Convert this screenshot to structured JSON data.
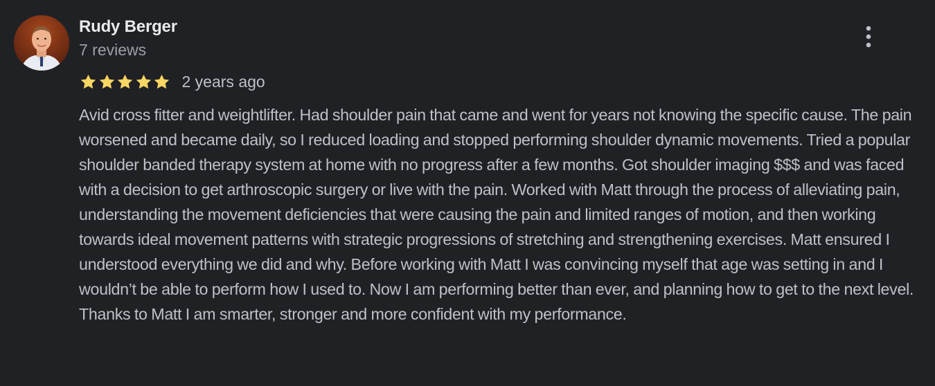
{
  "review": {
    "reviewer": {
      "name": "Rudy Berger",
      "review_count": "7 reviews",
      "avatar_icon": "user-photo-avatar"
    },
    "rating": {
      "stars": 5,
      "max_stars": 5,
      "star_color": "#fdd663"
    },
    "date": "2 years ago",
    "text": "Avid cross fitter and weightlifter. Had shoulder pain that came and went for years not knowing the specific cause. The pain worsened and became daily, so I reduced loading and stopped performing shoulder dynamic movements. Tried a popular shoulder banded therapy system at home with no progress after a few months. Got shoulder imaging $$$ and was faced with a decision to get arthroscopic surgery or live with the pain. Worked with Matt through the process of alleviating pain, understanding the movement deficiencies that were causing the pain and limited ranges of motion, and then working towards ideal movement patterns with strategic progressions of stretching and strengthening exercises. Matt ensured I understood everything we did and why. Before working with Matt I was convincing myself that age was setting in and I wouldn’t be able to perform how I used to. Now I am performing better than ever, and planning how to get to the next level. Thanks to Matt I am smarter, stronger and more confident with my performance.",
    "menu_icon": "more-vert-icon"
  },
  "colors": {
    "background": "#202124",
    "name": "#e8eaed",
    "secondary_text": "#9aa0a6",
    "body_text": "#bdc1c6"
  }
}
